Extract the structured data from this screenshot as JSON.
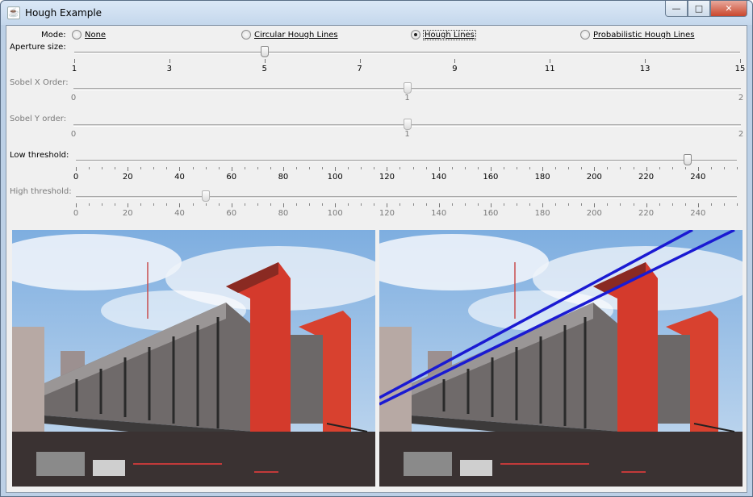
{
  "window": {
    "title": "Hough Example",
    "app_icon": "java-icon",
    "buttons": {
      "minimize": "—",
      "maximize": "□",
      "close": "✕"
    }
  },
  "mode": {
    "label": "Mode:",
    "options": [
      {
        "label": "None",
        "selected": false
      },
      {
        "label": "Circular Hough Lines",
        "selected": false
      },
      {
        "label": "Hough Lines",
        "selected": true
      },
      {
        "label": "Probabilistic Hough Lines",
        "selected": false
      }
    ]
  },
  "sliders": {
    "aperture": {
      "label": "Aperture size:",
      "min": 1,
      "max": 15,
      "value": 5,
      "enabled": true,
      "tick_labels": [
        "1",
        "3",
        "5",
        "7",
        "9",
        "11",
        "13",
        "15"
      ]
    },
    "sobel_x": {
      "label": "Sobel X Order:",
      "min": 0,
      "max": 2,
      "value": 1,
      "enabled": false,
      "tick_labels": [
        "0",
        "1",
        "2"
      ]
    },
    "sobel_y": {
      "label": "Sobel Y order:",
      "min": 0,
      "max": 2,
      "value": 1,
      "enabled": false,
      "tick_labels": [
        "0",
        "1",
        "2"
      ]
    },
    "low_threshold": {
      "label": "Low threshold:",
      "min": 0,
      "max": 255,
      "value": 236,
      "enabled": true,
      "tick_labels": [
        "0",
        "20",
        "40",
        "60",
        "80",
        "100",
        "120",
        "140",
        "160",
        "180",
        "200",
        "220",
        "240"
      ]
    },
    "high_threshold": {
      "label": "High threshold:",
      "min": 0,
      "max": 255,
      "value": 50,
      "enabled": false,
      "tick_labels": [
        "0",
        "20",
        "40",
        "60",
        "80",
        "100",
        "120",
        "140",
        "160",
        "180",
        "200",
        "220",
        "240"
      ]
    }
  },
  "images": {
    "original": "building-photo-original",
    "result": "building-photo-hough-lines",
    "line_color": "#1a1ad2"
  }
}
